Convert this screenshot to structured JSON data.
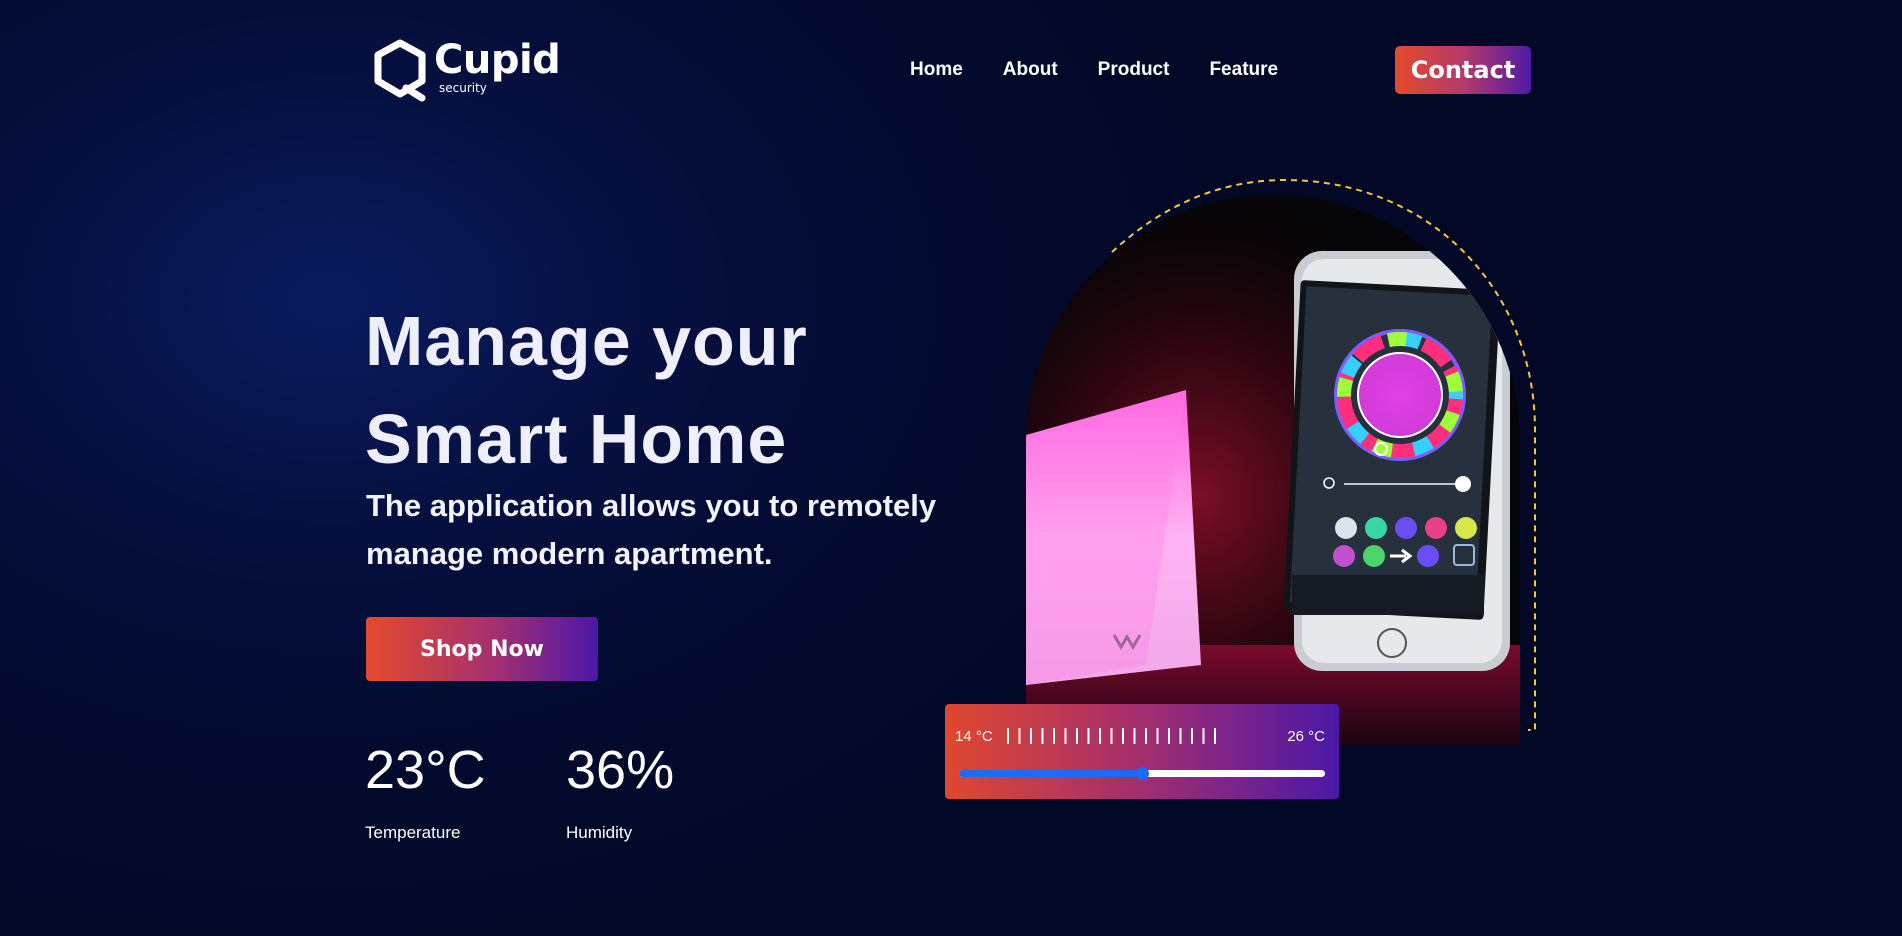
{
  "brand": {
    "name": "Cupid",
    "tagline": "security"
  },
  "nav": {
    "items": [
      {
        "label": "Home"
      },
      {
        "label": "About"
      },
      {
        "label": "Product"
      },
      {
        "label": "Feature"
      }
    ]
  },
  "contact_label": "Contact",
  "hero": {
    "title_line1": "Manage your",
    "title_line2": "Smart Home",
    "subtitle": "The application allows you to remotely manage modern apartment.",
    "cta_label": "Shop Now"
  },
  "stats": [
    {
      "value": "23°C",
      "label": "Temperature"
    },
    {
      "value": "36%",
      "label": "Humidity"
    }
  ],
  "thermostat": {
    "min_label": "14 °C",
    "max_label": "26 °C",
    "level_fraction": 0.5
  },
  "colors": {
    "accent_start": "#e44a2c",
    "accent_end": "#4f1ba5",
    "background": "#030a2e",
    "arc_dash": "#f5c842",
    "slider_blue": "#1a6cf5"
  },
  "icons": [
    "hexagon-logo-icon"
  ]
}
